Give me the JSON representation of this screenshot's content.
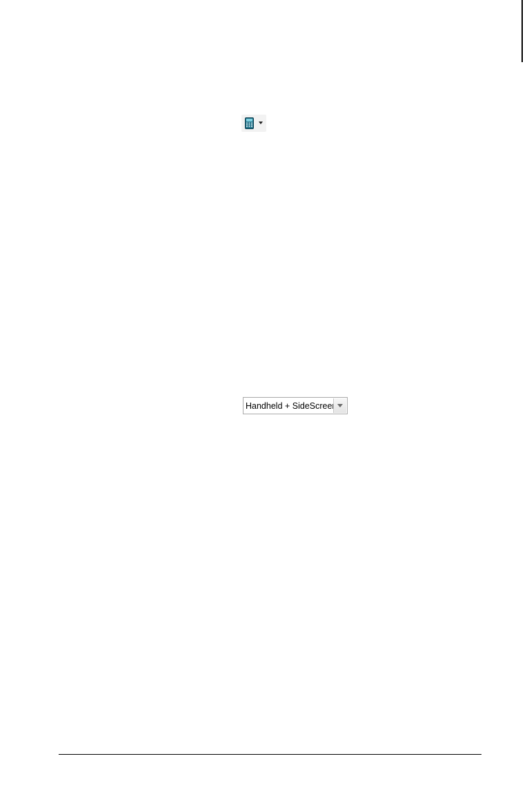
{
  "toolbar": {
    "handheld_button_icon": "calculator-icon",
    "dropdown_icon": "caret-down-icon"
  },
  "view_selector": {
    "selected": "Handheld + SideScreen",
    "arrow_icon": "chevron-down-icon"
  },
  "colors": {
    "calculator_body": "#1e6f86",
    "calculator_screen": "#7fd0e0",
    "button_bg": "#f2f2f2",
    "select_border": "#a9a9a9"
  }
}
